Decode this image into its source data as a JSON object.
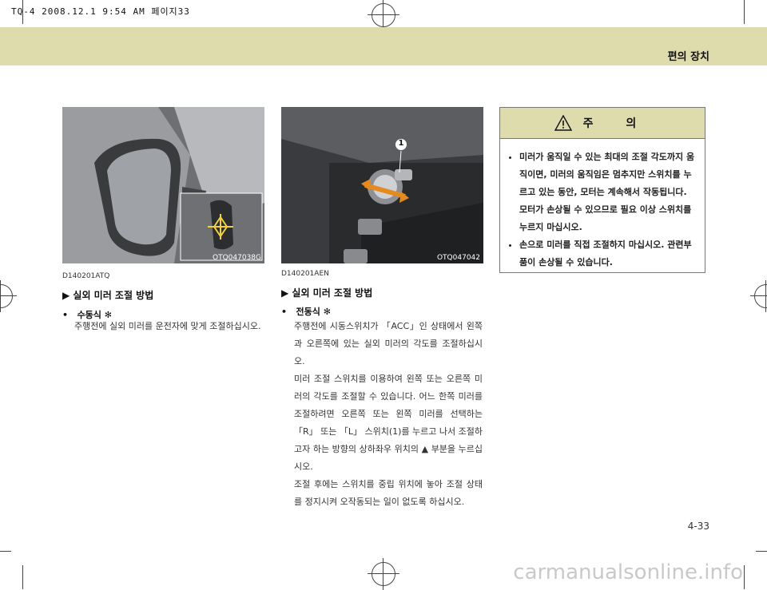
{
  "print_header": "TQ-4 2008.12.1 9:54 AM 페이지33",
  "section_title": "편의 장치",
  "left": {
    "photo_code": "OTQ047038G",
    "doc_code": "D140201ATQ",
    "heading": "▶ 실외 미러 조절 방법",
    "bullet_label": "수동식",
    "bullet_mark": "✻",
    "text": "주행전에 실외 미러를 운전자에 맞게 조절하십시오."
  },
  "middle": {
    "photo_code": "OTQ047042",
    "callout_number": "1",
    "doc_code": "D140201AEN",
    "heading": "▶ 실외 미러 조절 방법",
    "bullet_label": "전동식",
    "bullet_mark": "✻",
    "paragraphs": [
      "주행전에 시동스위치가 「ACC」인 상태에서 왼쪽과 오른쪽에 있는 실외 미러의 각도를 조절하십시오.",
      "미러 조절 스위치를 이용하여 왼쪽 또는 오른쪽 미러의 각도를 조절할 수 있습니다. 어느 한쪽 미러를 조절하려면 오른쪽 또는 왼쪽 미러를 선택하는 「R」 또는 「L」 스위치(1)를 누르고 나서 조절하고자 하는 방향의 상하좌우 위치의 ▲ 부분을 누르십시오.",
      "조절 후에는 스위치를 중립 위치에 놓아 조절 상태를 정지시켜 오작동되는 일이 없도록 하십시오."
    ]
  },
  "caution": {
    "title": "주 의",
    "items": [
      "미러가 움직일 수 있는 최대의 조절 각도까지 움직이면, 미러의 움직임은 멈추지만 스위치를 누르고 있는 동안, 모터는 계속해서 작동됩니다. 모터가 손상될 수 있으므로 필요 이상 스위치를 누르지 마십시오.",
      "손으로 미러를 직접 조절하지 마십시오. 관련부품이 손상될 수 있습니다."
    ]
  },
  "page_number": "4-33",
  "watermark": "carmanualsonline.info"
}
